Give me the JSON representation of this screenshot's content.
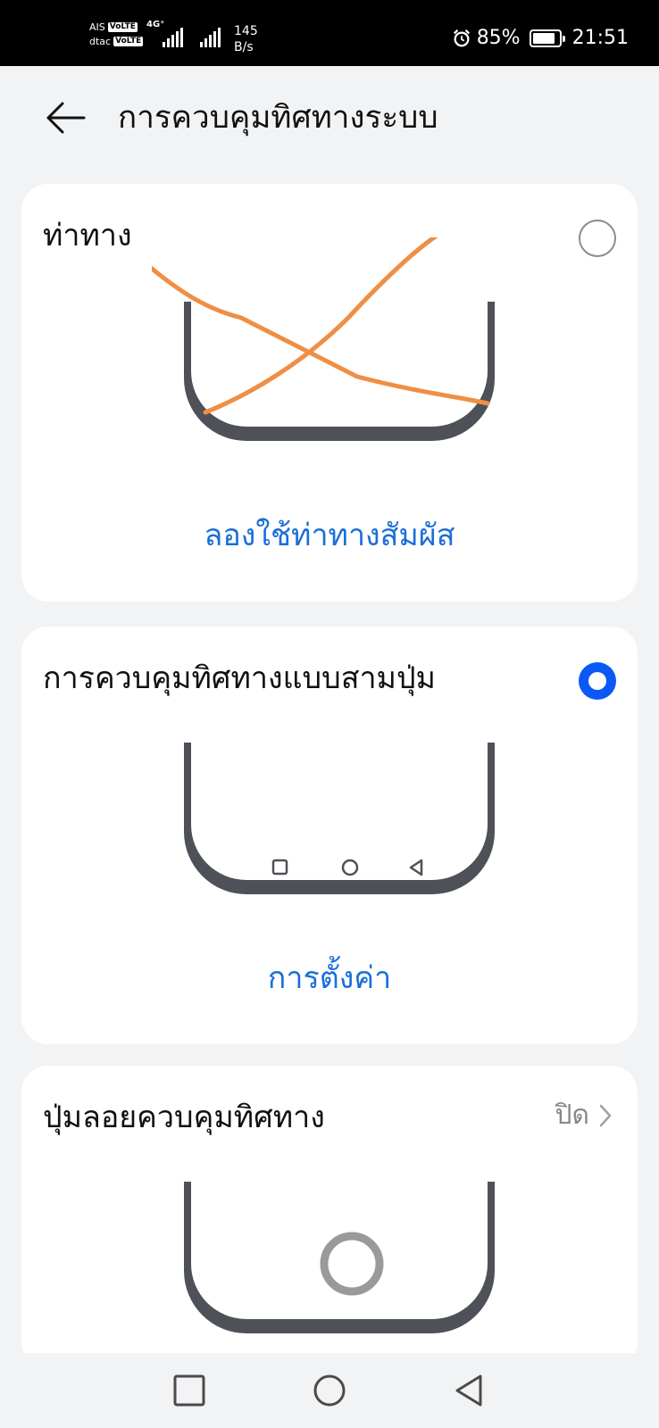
{
  "status_bar": {
    "carrier1": "AIS",
    "carrier2": "dtac",
    "volte": "VoLTE",
    "network": "4G⁺",
    "speed_value": "145",
    "speed_unit": "B/s",
    "battery": "85%",
    "battery_level": 0.85,
    "time": "21:51"
  },
  "header": {
    "title": "การควบคุมทิศทางระบบ"
  },
  "options": [
    {
      "title": "ท่าทาง",
      "selected": false,
      "link": "ลองใช้ท่าทางสัมผัส"
    },
    {
      "title": "การควบคุมทิศทางแบบสามปุ่ม",
      "selected": true,
      "link": "การตั้งค่า"
    }
  ],
  "floating": {
    "title": "ปุ่มลอยควบคุมทิศทาง",
    "value": "ปิด"
  },
  "colors": {
    "accent": "#0a59f7",
    "link": "#1a6fd8",
    "phone_frame": "#4e5158",
    "annotation": "#ef8f45"
  },
  "icons": {
    "back": "arrow-left-icon",
    "chevron": "chevron-right-icon",
    "nav": [
      "square-icon",
      "circle-icon",
      "triangle-back-icon"
    ]
  }
}
